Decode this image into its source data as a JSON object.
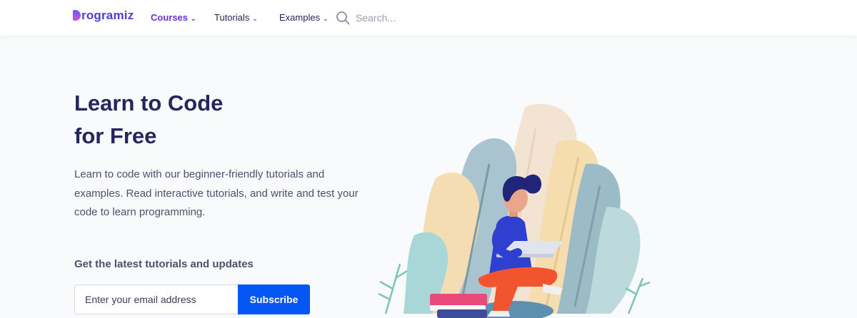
{
  "brand": {
    "name": "rogramiz",
    "mark_letter": "P",
    "color": "#4a3fd6"
  },
  "nav": {
    "items": [
      {
        "label": "Courses",
        "active": true
      },
      {
        "label": "Tutorials",
        "active": false
      },
      {
        "label": "Examples",
        "active": false
      }
    ],
    "chevron": "⌄",
    "search_placeholder": "Search...",
    "search_icon": "search-icon"
  },
  "hero": {
    "title_line1": "Learn to Code",
    "title_line2": "for Free",
    "description": "Learn to code with our beginner-friendly tutorials and examples. Read interactive tutorials, and write and test your code to learn programming."
  },
  "newsletter": {
    "heading": "Get the latest tutorials and updates",
    "email_placeholder": "Enter your email address",
    "button_label": "Subscribe"
  },
  "colors": {
    "accent": "#6d2fe0",
    "button": "#0556f3",
    "text_dark": "#25265e",
    "text_muted": "#4d4f6e"
  }
}
